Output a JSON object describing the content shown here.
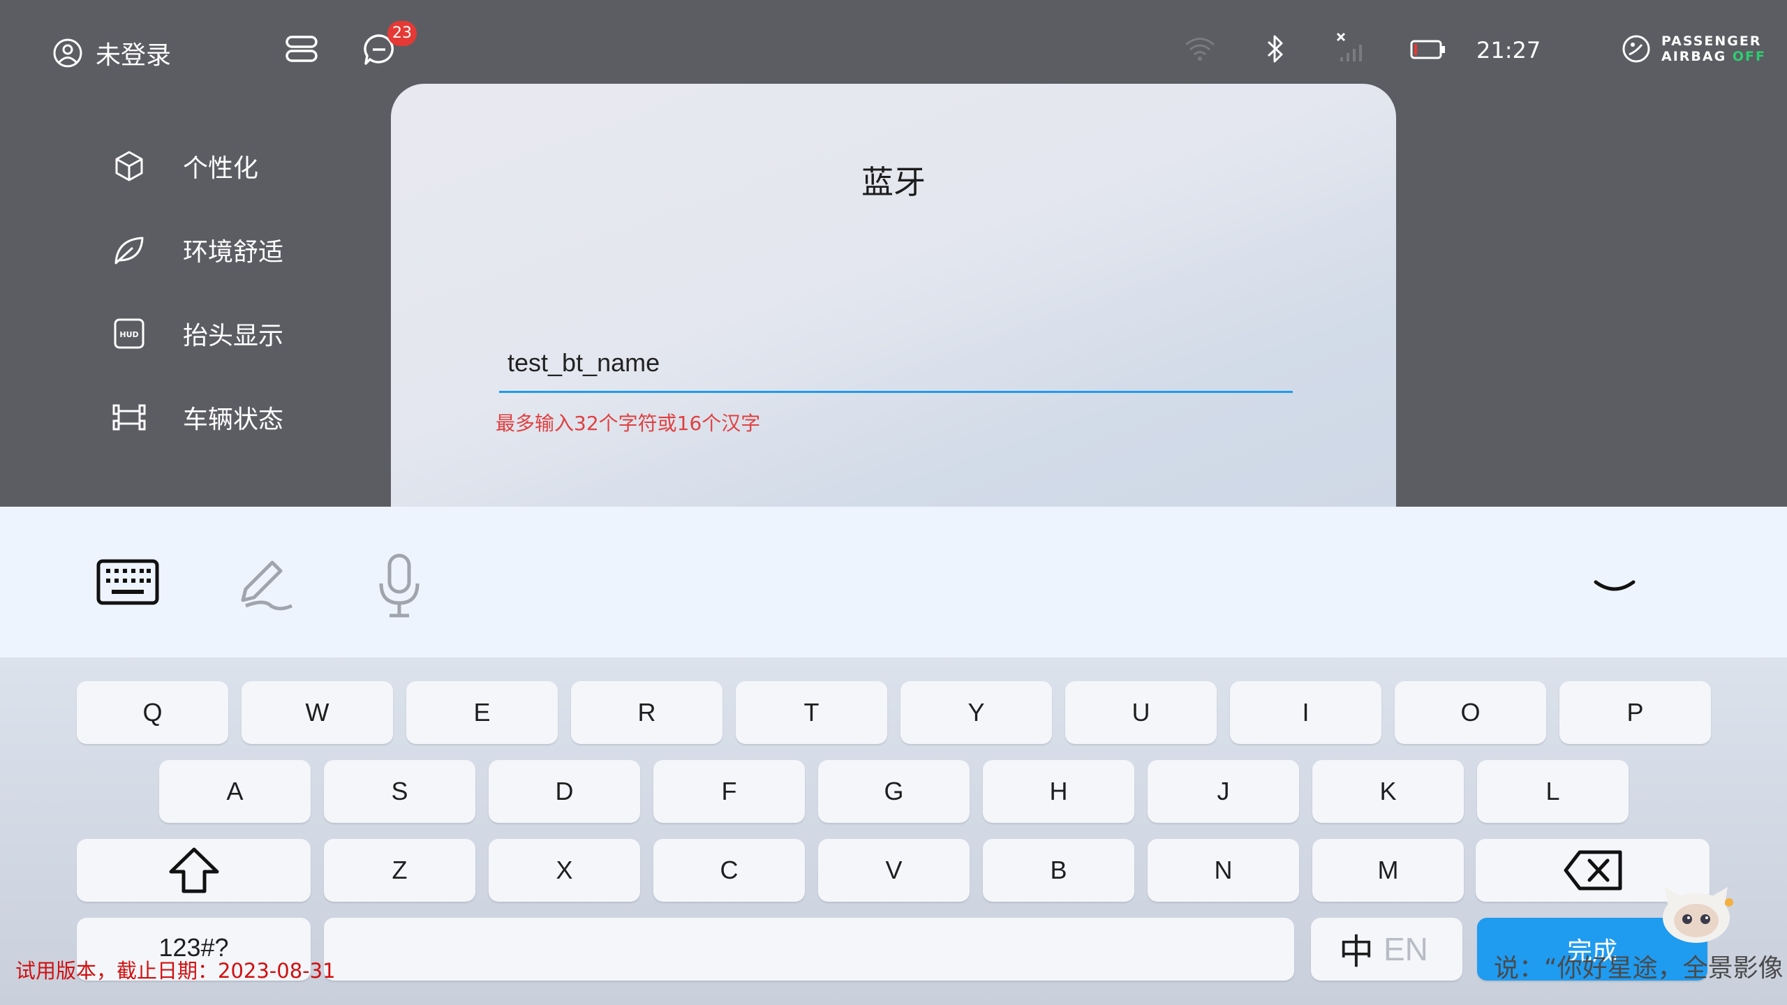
{
  "status_bar": {
    "user_label": "未登录",
    "message_badge": "23",
    "time": "21:27",
    "airbag_line1": "PASSENGER",
    "airbag_line2": "AIRBAG",
    "airbag_state": "OFF",
    "icons": [
      "user-icon",
      "settings-toggle-icon",
      "message-icon",
      "wifi-icon",
      "bluetooth-icon",
      "signal-off-icon",
      "battery-icon",
      "airbag-icon"
    ]
  },
  "sidebar": {
    "items": [
      {
        "label": "个性化",
        "icon": "cube-icon"
      },
      {
        "label": "环境舒适",
        "icon": "leaf-icon"
      },
      {
        "label": "抬头显示",
        "icon": "hud-icon"
      },
      {
        "label": "车辆状态",
        "icon": "vehicle-icon"
      }
    ]
  },
  "dialog": {
    "title": "蓝牙",
    "input_value": "test_bt_name",
    "hint": "最多输入32个字符或16个汉字"
  },
  "keyboard": {
    "toolbar": [
      "keyboard-icon",
      "handwriting-icon",
      "microphone-icon",
      "collapse-icon"
    ],
    "row1": [
      "Q",
      "W",
      "E",
      "R",
      "T",
      "Y",
      "U",
      "I",
      "O",
      "P"
    ],
    "row2": [
      "A",
      "S",
      "D",
      "F",
      "G",
      "H",
      "J",
      "K",
      "L"
    ],
    "row3": [
      "Z",
      "X",
      "C",
      "V",
      "B",
      "N",
      "M"
    ],
    "symbols_label": "123#?",
    "lang_label": "中",
    "lang_alt": "EN",
    "done_label": "完成"
  },
  "overlay": {
    "trial_notice": "试用版本，截止日期：2023-08-31",
    "voice_hint": "说：“你好星途，全景影像"
  },
  "colors": {
    "accent": "#1f9bf0",
    "hint_red": "#e04040",
    "badge_red": "#e53935",
    "airbag_green": "#2ecc71"
  }
}
